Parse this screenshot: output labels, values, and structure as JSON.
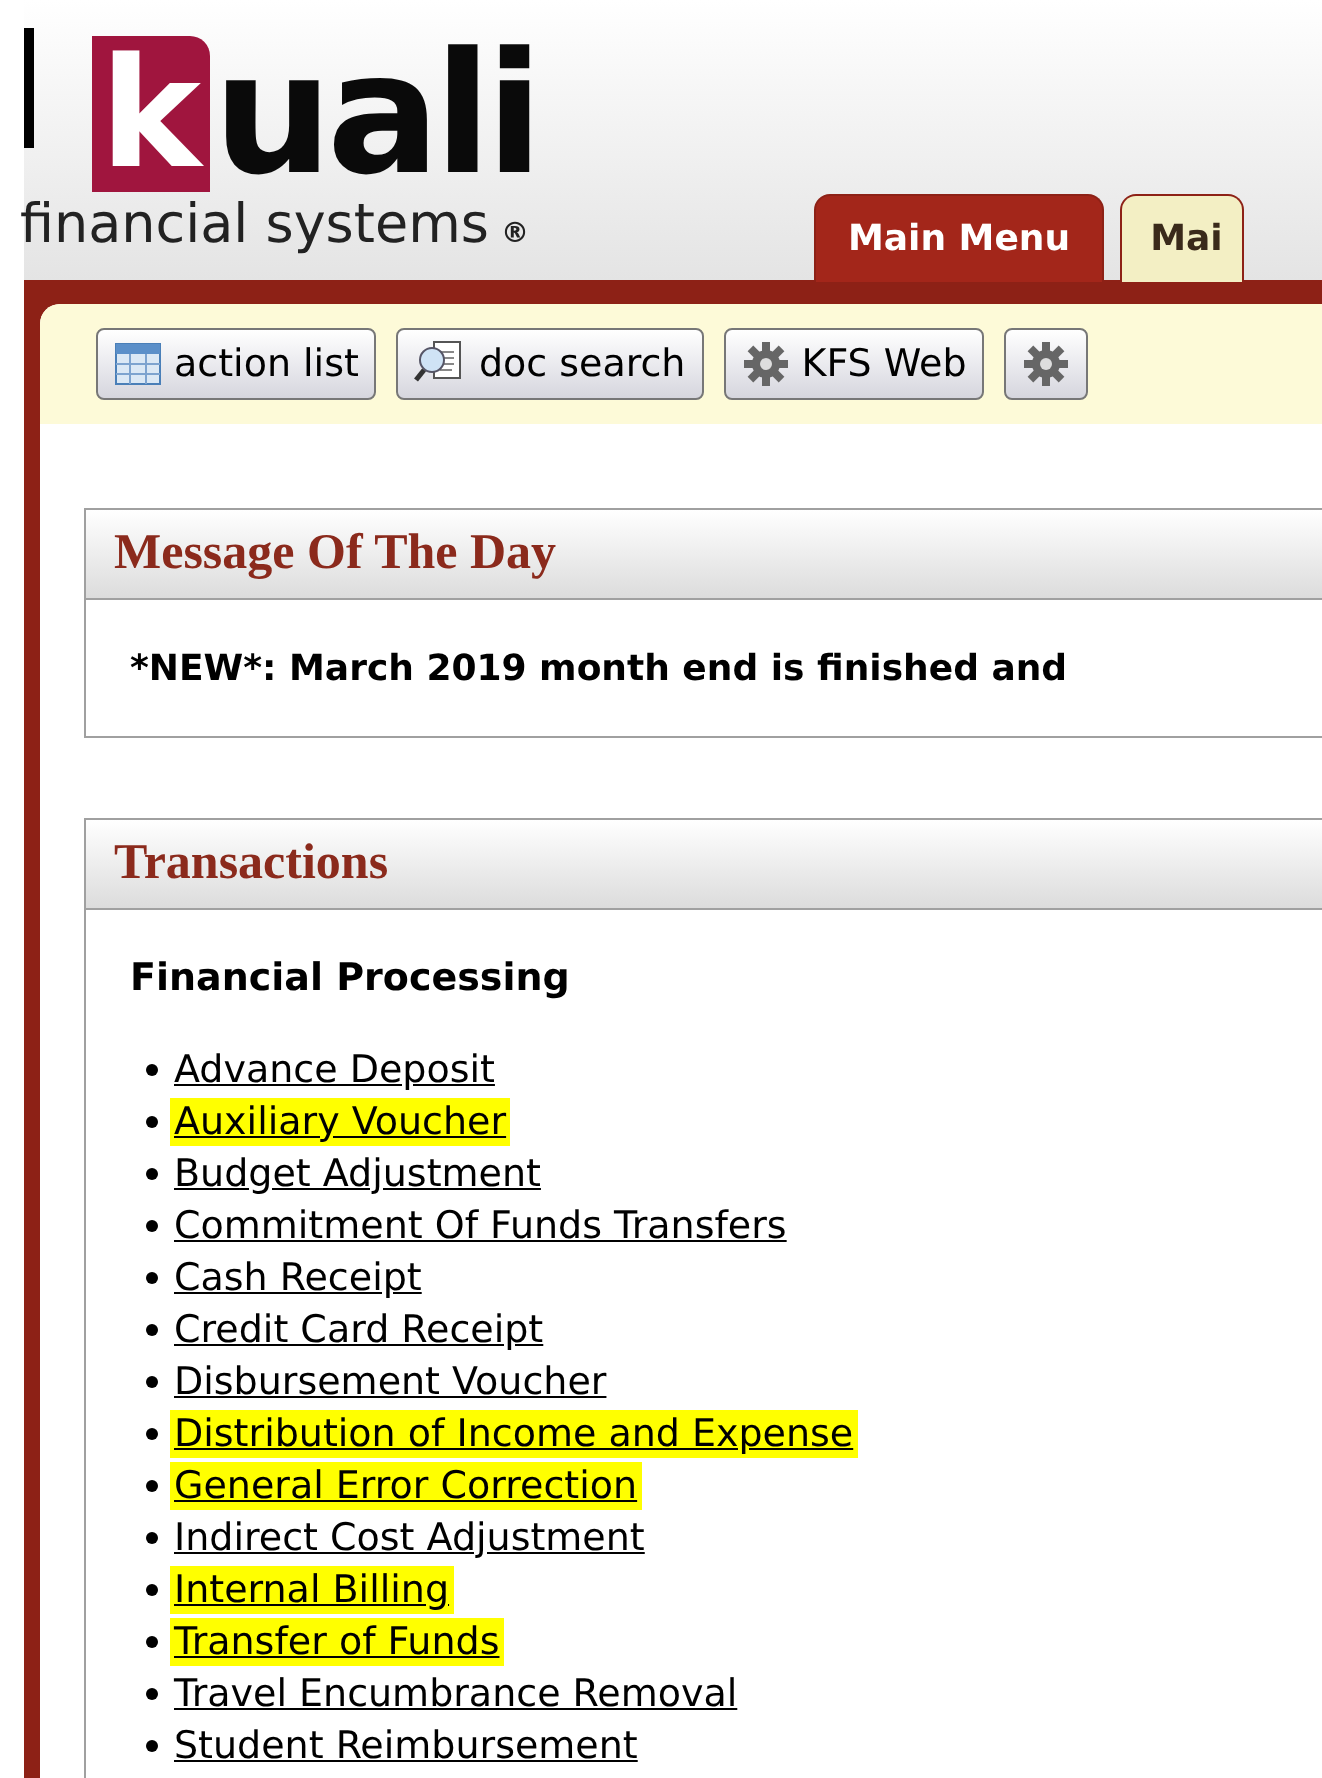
{
  "logo": {
    "initial": "k",
    "rest": "uali",
    "tagline": "financial systems",
    "mark": "®"
  },
  "tabs": [
    {
      "label": "Main Menu",
      "selected": true
    },
    {
      "label": "Mai",
      "selected": false
    }
  ],
  "toolbar": [
    {
      "label": "action list",
      "kind": "table"
    },
    {
      "label": "doc search",
      "kind": "search"
    },
    {
      "label": "KFS Web",
      "kind": "gear"
    },
    {
      "kind": "gear"
    }
  ],
  "message_of_the_day": {
    "title": "Message Of The Day",
    "text": "*NEW*: March 2019 month end is finished and"
  },
  "transactions": {
    "title": "Transactions",
    "section": "Financial Processing",
    "items": [
      {
        "label": "Advance Deposit",
        "highlighted": false
      },
      {
        "label": "Auxiliary Voucher",
        "highlighted": true
      },
      {
        "label": "Budget Adjustment",
        "highlighted": false
      },
      {
        "label": "Commitment Of Funds Transfers",
        "highlighted": false
      },
      {
        "label": "Cash Receipt",
        "highlighted": false
      },
      {
        "label": "Credit Card Receipt",
        "highlighted": false
      },
      {
        "label": "Disbursement Voucher",
        "highlighted": false
      },
      {
        "label": "Distribution of Income and Expense",
        "highlighted": true
      },
      {
        "label": "General Error Correction",
        "highlighted": true
      },
      {
        "label": "Indirect Cost Adjustment",
        "highlighted": false
      },
      {
        "label": "Internal Billing",
        "highlighted": true
      },
      {
        "label": "Transfer of Funds",
        "highlighted": true
      },
      {
        "label": "Travel Encumbrance Removal",
        "highlighted": false
      },
      {
        "label": "Student Reimbursement",
        "highlighted": false
      }
    ]
  }
}
